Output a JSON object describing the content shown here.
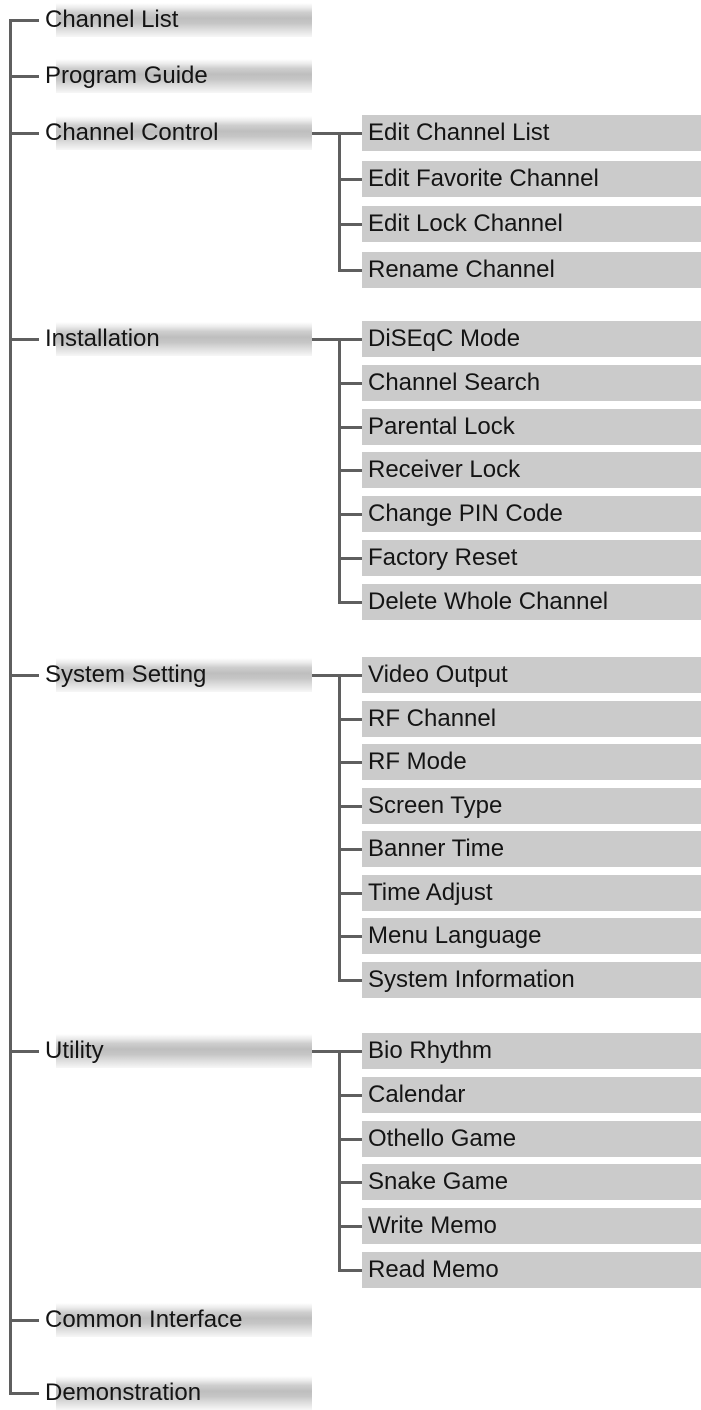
{
  "menu": [
    {
      "label": "Channel List",
      "items": []
    },
    {
      "label": "Program Guide",
      "items": []
    },
    {
      "label": "Channel Control",
      "items": [
        "Edit Channel List",
        "Edit Favorite Channel",
        "Edit Lock Channel",
        "Rename Channel"
      ]
    },
    {
      "label": "Installation",
      "items": [
        "DiSEqC Mode",
        "Channel Search",
        "Parental Lock",
        "Receiver Lock",
        "Change PIN Code",
        "Factory Reset",
        "Delete Whole  Channel"
      ]
    },
    {
      "label": "System Setting",
      "items": [
        "Video Output",
        "RF Channel",
        "RF Mode",
        "Screen Type",
        "Banner Time",
        "Time Adjust",
        "Menu Language",
        "System Information"
      ]
    },
    {
      "label": "Utility",
      "items": [
        "Bio Rhythm",
        "Calendar",
        "Othello Game",
        "Snake Game",
        "Write Memo",
        "Read Memo"
      ]
    },
    {
      "label": "Common Interface",
      "items": []
    },
    {
      "label": "Demonstration",
      "items": []
    }
  ],
  "colors": {
    "connector": "#5f5f5f",
    "submenu_bar": "#cbcbcb",
    "text": "#141414"
  }
}
